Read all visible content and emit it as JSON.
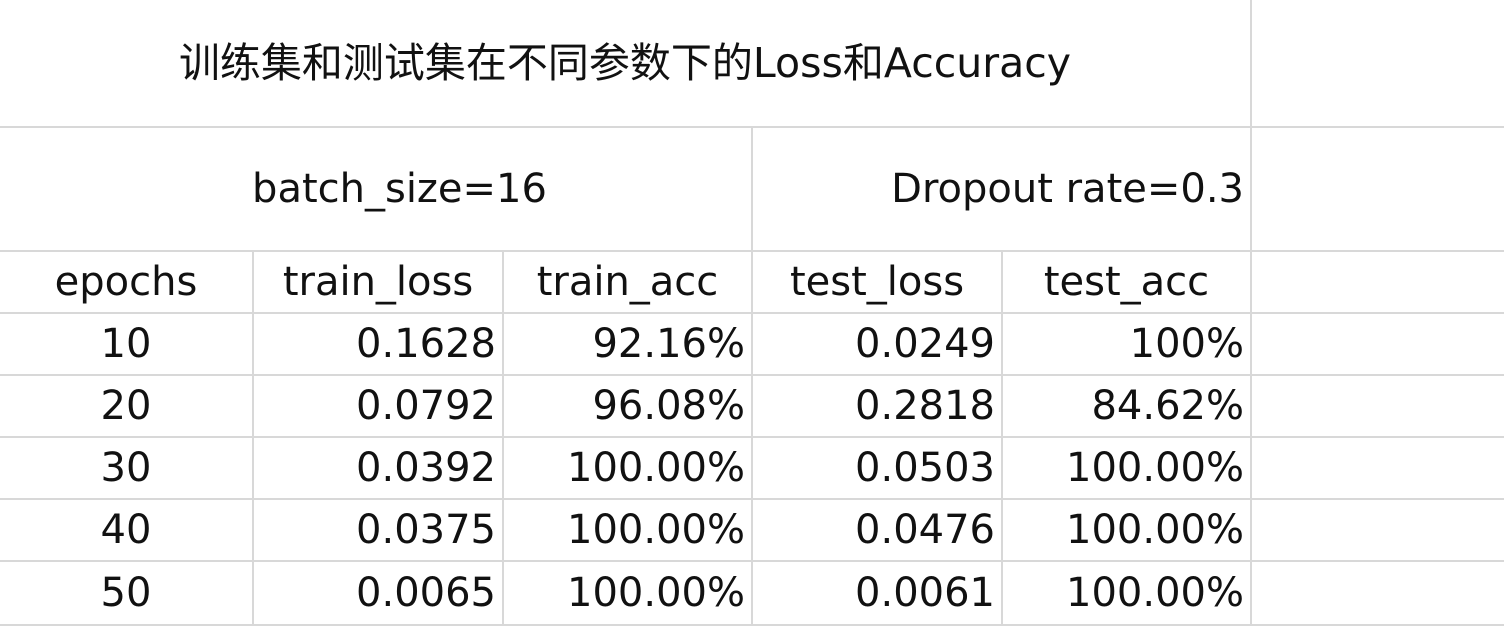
{
  "title": "训练集和测试集在不同参数下的Loss和Accuracy",
  "params": {
    "batch_size": "batch_size=16",
    "dropout": "Dropout rate=0.3"
  },
  "table": {
    "headers": [
      "epochs",
      "train_loss",
      "train_acc",
      "test_loss",
      "test_acc"
    ],
    "rows": [
      [
        "10",
        "0.1628",
        "92.16%",
        "0.0249",
        "100%"
      ],
      [
        "20",
        "0.0792",
        "96.08%",
        "0.2818",
        "84.62%"
      ],
      [
        "30",
        "0.0392",
        "100.00%",
        "0.0503",
        "100.00%"
      ],
      [
        "40",
        "0.0375",
        "100.00%",
        "0.0476",
        "100.00%"
      ],
      [
        "50",
        "0.0065",
        "100.00%",
        "0.0061",
        "100.00%"
      ]
    ]
  },
  "colors": {
    "gridline": "#d8d8d8",
    "text": "#111111",
    "background": "#ffffff"
  }
}
